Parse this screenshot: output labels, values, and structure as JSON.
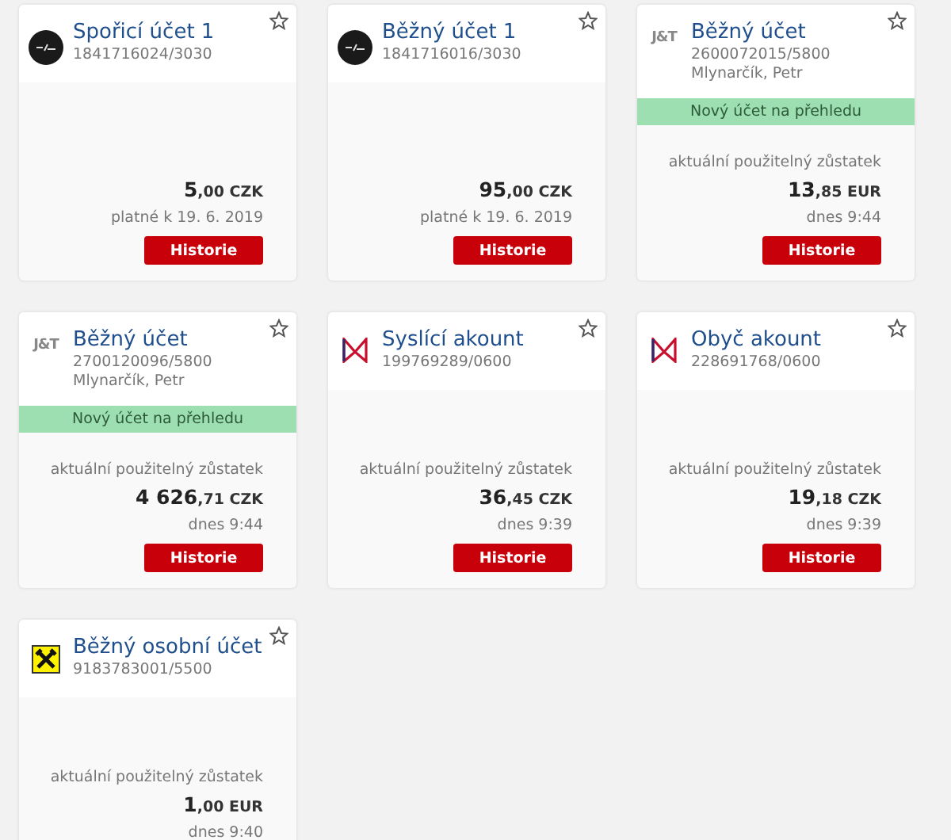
{
  "accounts": [
    {
      "logo": {
        "kind": "mbank"
      },
      "name": "Spořicí účet 1",
      "number": "1841716024/3030",
      "amount_int": "5",
      "amount_dec": ",00",
      "currency": "CZK",
      "date": "platné k 19. 6. 2019",
      "button": "Historie",
      "starred": false
    },
    {
      "logo": {
        "kind": "mbank"
      },
      "name": "Běžný účet 1",
      "number": "1841716016/3030",
      "amount_int": "95",
      "amount_dec": ",00",
      "currency": "CZK",
      "date": "platné k 19. 6. 2019",
      "button": "Historie",
      "starred": false
    },
    {
      "logo": {
        "kind": "jt",
        "text": "J&T"
      },
      "name": "Běžný účet",
      "number": "2600072015/5800",
      "owner": "Mlynarčík, Petr",
      "banner": "Nový účet na přehledu",
      "balance_label": "aktuální použitelný zůstatek",
      "amount_int": "13",
      "amount_dec": ",85",
      "currency": "EUR",
      "date": "dnes 9:44",
      "button": "Historie",
      "starred": false
    },
    {
      "logo": {
        "kind": "jt",
        "text": "J&T"
      },
      "name": "Běžný účet",
      "number": "2700120096/5800",
      "owner": "Mlynarčík, Petr",
      "banner": "Nový účet na přehledu",
      "balance_label": "aktuální použitelný zůstatek",
      "amount_int": "4 626",
      "amount_dec": ",71",
      "currency": "CZK",
      "date": "dnes 9:44",
      "button": "Historie",
      "starred": false
    },
    {
      "logo": {
        "kind": "moneta"
      },
      "name": "Syslící akount",
      "number": "199769289/0600",
      "balance_label": "aktuální použitelný zůstatek",
      "amount_int": "36",
      "amount_dec": ",45",
      "currency": "CZK",
      "date": "dnes 9:39",
      "button": "Historie",
      "starred": false
    },
    {
      "logo": {
        "kind": "moneta"
      },
      "name": "Obyč akount",
      "number": "228691768/0600",
      "balance_label": "aktuální použitelný zůstatek",
      "amount_int": "19",
      "amount_dec": ",18",
      "currency": "CZK",
      "date": "dnes 9:39",
      "button": "Historie",
      "starred": false
    },
    {
      "logo": {
        "kind": "raiffeisen"
      },
      "name": "Běžný osobní účet",
      "number": "9183783001/5500",
      "balance_label": "aktuální použitelný zůstatek",
      "amount_int": "1",
      "amount_dec": ",00",
      "currency": "EUR",
      "date": "dnes 9:40",
      "starred": false
    }
  ]
}
